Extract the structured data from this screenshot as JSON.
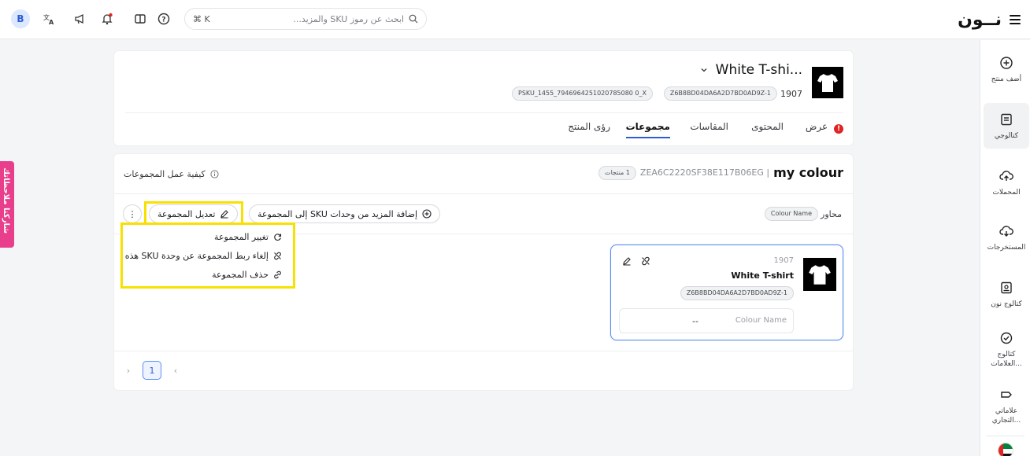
{
  "topbar": {
    "logo_text": "نــون",
    "search_placeholder": "ابحث عن رموز SKU والمزيد...",
    "search_shortcut": "⌘ K",
    "user_initial": "B"
  },
  "sidebar": {
    "items": [
      {
        "label": "أضف منتج",
        "icon": "plus-circle-icon"
      },
      {
        "label": "كتالوجي",
        "icon": "catalog-icon"
      },
      {
        "label": "المحملات",
        "icon": "upload-cloud-icon"
      },
      {
        "label": "المستخرجات",
        "icon": "download-cloud-icon"
      },
      {
        "label": "كتالوج نون",
        "icon": "noon-catalog-icon"
      },
      {
        "label": "كتالوج العلامات...",
        "icon": "brand-catalog-icon"
      },
      {
        "label": "علاماتي التجاري...",
        "icon": "my-brands-icon"
      }
    ]
  },
  "feedback": {
    "label": "شاركنا ملاحظاتك"
  },
  "product": {
    "title": "White T-shi...",
    "id": "1907",
    "sku_chip": "Z6B8BD04DA6A2D7BD0AD9Z-1",
    "psku_chip": "PSKU_1455_7946964251020785080 0_X",
    "tabs": [
      {
        "label": "عرض",
        "alert": "!"
      },
      {
        "label": "المحتوى"
      },
      {
        "label": "المقاسات"
      },
      {
        "label": "مجموعات"
      },
      {
        "label": "رؤى المنتج"
      }
    ]
  },
  "group": {
    "name": "my colour",
    "code": "ZEA6C2220SF38E117B06EG |",
    "count_chip": "1 منتجات",
    "how_it_works": "كيفية عمل المجموعات",
    "axes_label": "محاور",
    "axis_chip": "Colour Name",
    "add_more_label": "إضافة المزيد من وحدات SKU إلى المجموعة",
    "edit_label": "تعديل المجموعة",
    "more_label": "⋮",
    "menu": [
      {
        "label": "تغيير المجموعة",
        "icon": "refresh-icon"
      },
      {
        "label": "إلغاء ربط المجموعة عن وحدة SKU هذه",
        "icon": "unlink-icon"
      },
      {
        "label": "حذف المجموعة",
        "icon": "link-icon"
      }
    ],
    "sku_card": {
      "id": "1907",
      "title": "White T-shirt",
      "sku_chip": "Z6B8BD04DA6A2D7BD0AD9Z-1",
      "attr_label": "Colour Name",
      "attr_value": "--"
    },
    "pager": {
      "current": "1",
      "prev": "›",
      "next": "‹"
    }
  },
  "colors": {
    "accent": "#2f5bd3",
    "highlight": "#f7e100",
    "feedback": "#e83e8c",
    "alert": "#e02424"
  }
}
